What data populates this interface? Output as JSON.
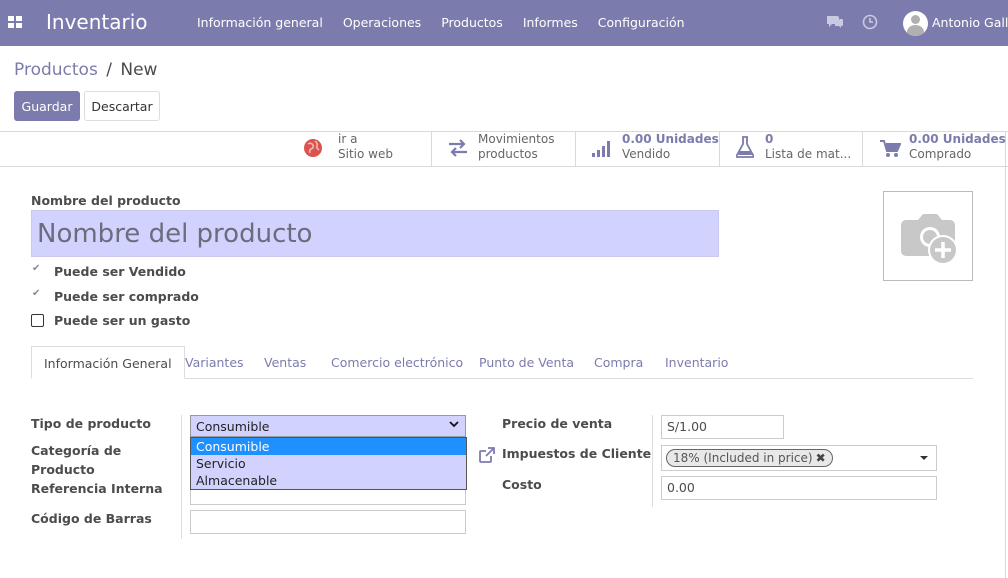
{
  "app": {
    "title": "Inventario",
    "menu": [
      "Información general",
      "Operaciones",
      "Productos",
      "Informes",
      "Configuración"
    ],
    "user": "Antonio Galli",
    "accent": "#7c7bad"
  },
  "breadcrumb": {
    "parent": "Productos",
    "separator": "/",
    "current": "New"
  },
  "buttons": {
    "save": "Guardar",
    "discard": "Descartar"
  },
  "smart_buttons": [
    {
      "icon": "globe-icon",
      "line1": "ir a",
      "line2": "Sitio web"
    },
    {
      "icon": "transfer-arrows-icon",
      "line1": "Movimientos",
      "line2": "productos"
    },
    {
      "icon": "bar-chart-icon",
      "line1": "0.00 Unidades",
      "line2": "Vendido"
    },
    {
      "icon": "flask-icon",
      "line1": "0",
      "line2": "Lista de mat..."
    },
    {
      "icon": "cart-icon",
      "line1": "0.00 Unidades",
      "line2": "Comprado"
    }
  ],
  "form": {
    "name_label": "Nombre del producto",
    "name_placeholder": "Nombre del producto",
    "checkboxes": [
      {
        "label": "Puede ser Vendido",
        "checked": true
      },
      {
        "label": "Puede ser comprado",
        "checked": true
      },
      {
        "label": "Puede ser un gasto",
        "checked": false
      }
    ]
  },
  "tabs": [
    "Información General",
    "Variantes",
    "Ventas",
    "Comercio electrónico",
    "Punto de Venta",
    "Compra",
    "Inventario"
  ],
  "general_tab": {
    "tipo_label": "Tipo de producto",
    "tipo_value": "Consumible",
    "tipo_options": [
      "Consumible",
      "Servicio",
      "Almacenable"
    ],
    "categoria_label_1": "Categoría de",
    "categoria_label_2": "Producto",
    "referencia_label": "Referencia Interna",
    "barras_label": "Código de Barras",
    "precio_label": "Precio de venta",
    "precio_value": "S/1.00",
    "impuestos_label": "Impuestos de Cliente",
    "impuestos_tag": "18% (Included in price)",
    "costo_label": "Costo",
    "costo_value": "0.00"
  }
}
